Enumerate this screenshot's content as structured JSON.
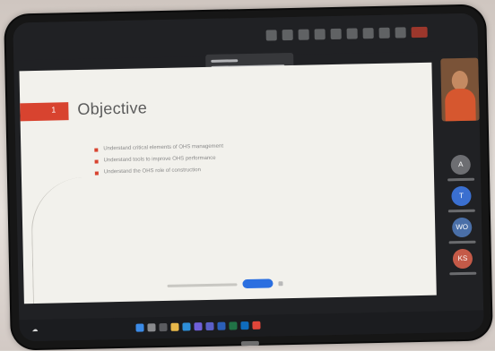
{
  "slide": {
    "number": "1",
    "title": "Objective",
    "bullets": [
      "Understand critical elements of OHS management",
      "Understand tools to improve OHS performance",
      "Understand the OHS role of construction"
    ]
  },
  "colors": {
    "accent": "#d8432f",
    "stop_button": "#2b6fe0",
    "leave_button": "#b33b2e"
  },
  "participants": [
    {
      "initial": "A",
      "color": "#6d6e72"
    },
    {
      "initial": "T",
      "color": "#3a6fd0"
    },
    {
      "initial": "WO",
      "color": "#4a6fa8"
    },
    {
      "initial": "KS",
      "color": "#c45a48"
    }
  ],
  "icons": {
    "controls": [
      "chat-icon",
      "people-icon",
      "react-icon",
      "view-icon",
      "rooms-icon",
      "more-icon",
      "camera-icon",
      "mic-icon",
      "share-icon",
      "leave-icon"
    ],
    "taskbar": [
      "start-icon",
      "search-icon",
      "taskview-icon",
      "explorer-icon",
      "edge-icon",
      "store-icon",
      "teams-icon",
      "word-icon",
      "excel-icon",
      "outlook-icon",
      "chrome-icon"
    ]
  }
}
